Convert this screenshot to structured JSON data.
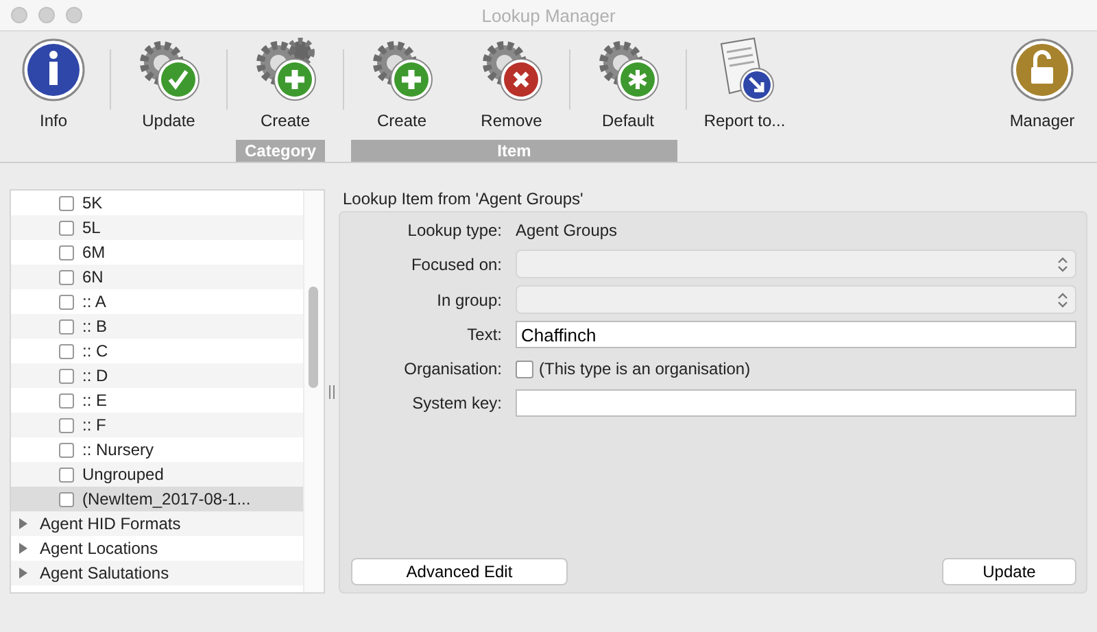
{
  "window": {
    "title": "Lookup Manager"
  },
  "toolbar_sections": [
    [
      {
        "kind": "info",
        "label": "Info"
      }
    ],
    [
      {
        "kind": "gear-check",
        "label": "Update"
      }
    ],
    [
      {
        "kind": "gears-plus",
        "label": "Create"
      }
    ],
    [
      {
        "kind": "gear-plus",
        "label": "Create"
      },
      {
        "kind": "gear-cross",
        "label": "Remove"
      }
    ],
    [
      {
        "kind": "gear-star",
        "label": "Default"
      }
    ],
    [
      {
        "kind": "report",
        "label": "Report to..."
      },
      {
        "kind": "lock",
        "label": "Manager"
      }
    ]
  ],
  "toolbar_groups": [
    {
      "label": "Category"
    },
    {
      "label": "Item"
    }
  ],
  "tree": [
    {
      "kind": "item",
      "label": "5K",
      "checked": false,
      "selected": false
    },
    {
      "kind": "item",
      "label": "5L",
      "checked": false,
      "selected": false
    },
    {
      "kind": "item",
      "label": "6M",
      "checked": false,
      "selected": false
    },
    {
      "kind": "item",
      "label": "6N",
      "checked": false,
      "selected": false
    },
    {
      "kind": "item",
      "label": ":: A",
      "checked": false,
      "selected": false
    },
    {
      "kind": "item",
      "label": ":: B",
      "checked": false,
      "selected": false
    },
    {
      "kind": "item",
      "label": ":: C",
      "checked": false,
      "selected": false
    },
    {
      "kind": "item",
      "label": ":: D",
      "checked": false,
      "selected": false
    },
    {
      "kind": "item",
      "label": ":: E",
      "checked": false,
      "selected": false
    },
    {
      "kind": "item",
      "label": ":: F",
      "checked": false,
      "selected": false
    },
    {
      "kind": "item",
      "label": ":: Nursery",
      "checked": false,
      "selected": false
    },
    {
      "kind": "item",
      "label": "Ungrouped",
      "checked": false,
      "selected": false
    },
    {
      "kind": "item",
      "label": "(NewItem_2017-08-1...",
      "checked": false,
      "selected": true
    },
    {
      "kind": "category",
      "label": "Agent HID Formats",
      "expanded": false,
      "selected": false
    },
    {
      "kind": "category",
      "label": "Agent Locations",
      "expanded": false,
      "selected": false
    },
    {
      "kind": "category",
      "label": "Agent Salutations",
      "expanded": false,
      "selected": false
    }
  ],
  "detail": {
    "title": "Lookup Item from 'Agent Groups'",
    "rows": [
      {
        "kind": "static",
        "label": "Lookup type:",
        "value": "Agent Groups"
      },
      {
        "kind": "select",
        "label": "Focused on:",
        "disabled": true
      },
      {
        "kind": "select",
        "label": "In group:",
        "disabled": true
      },
      {
        "kind": "input",
        "label": "Text:",
        "value": "Chaffinch"
      },
      {
        "kind": "checkbox",
        "label": "Organisation:",
        "checked": false,
        "text": "(This type is an organisation)"
      },
      {
        "kind": "input",
        "label": "System key:"
      }
    ],
    "buttons": [
      "Advanced Edit",
      "Update"
    ]
  }
}
